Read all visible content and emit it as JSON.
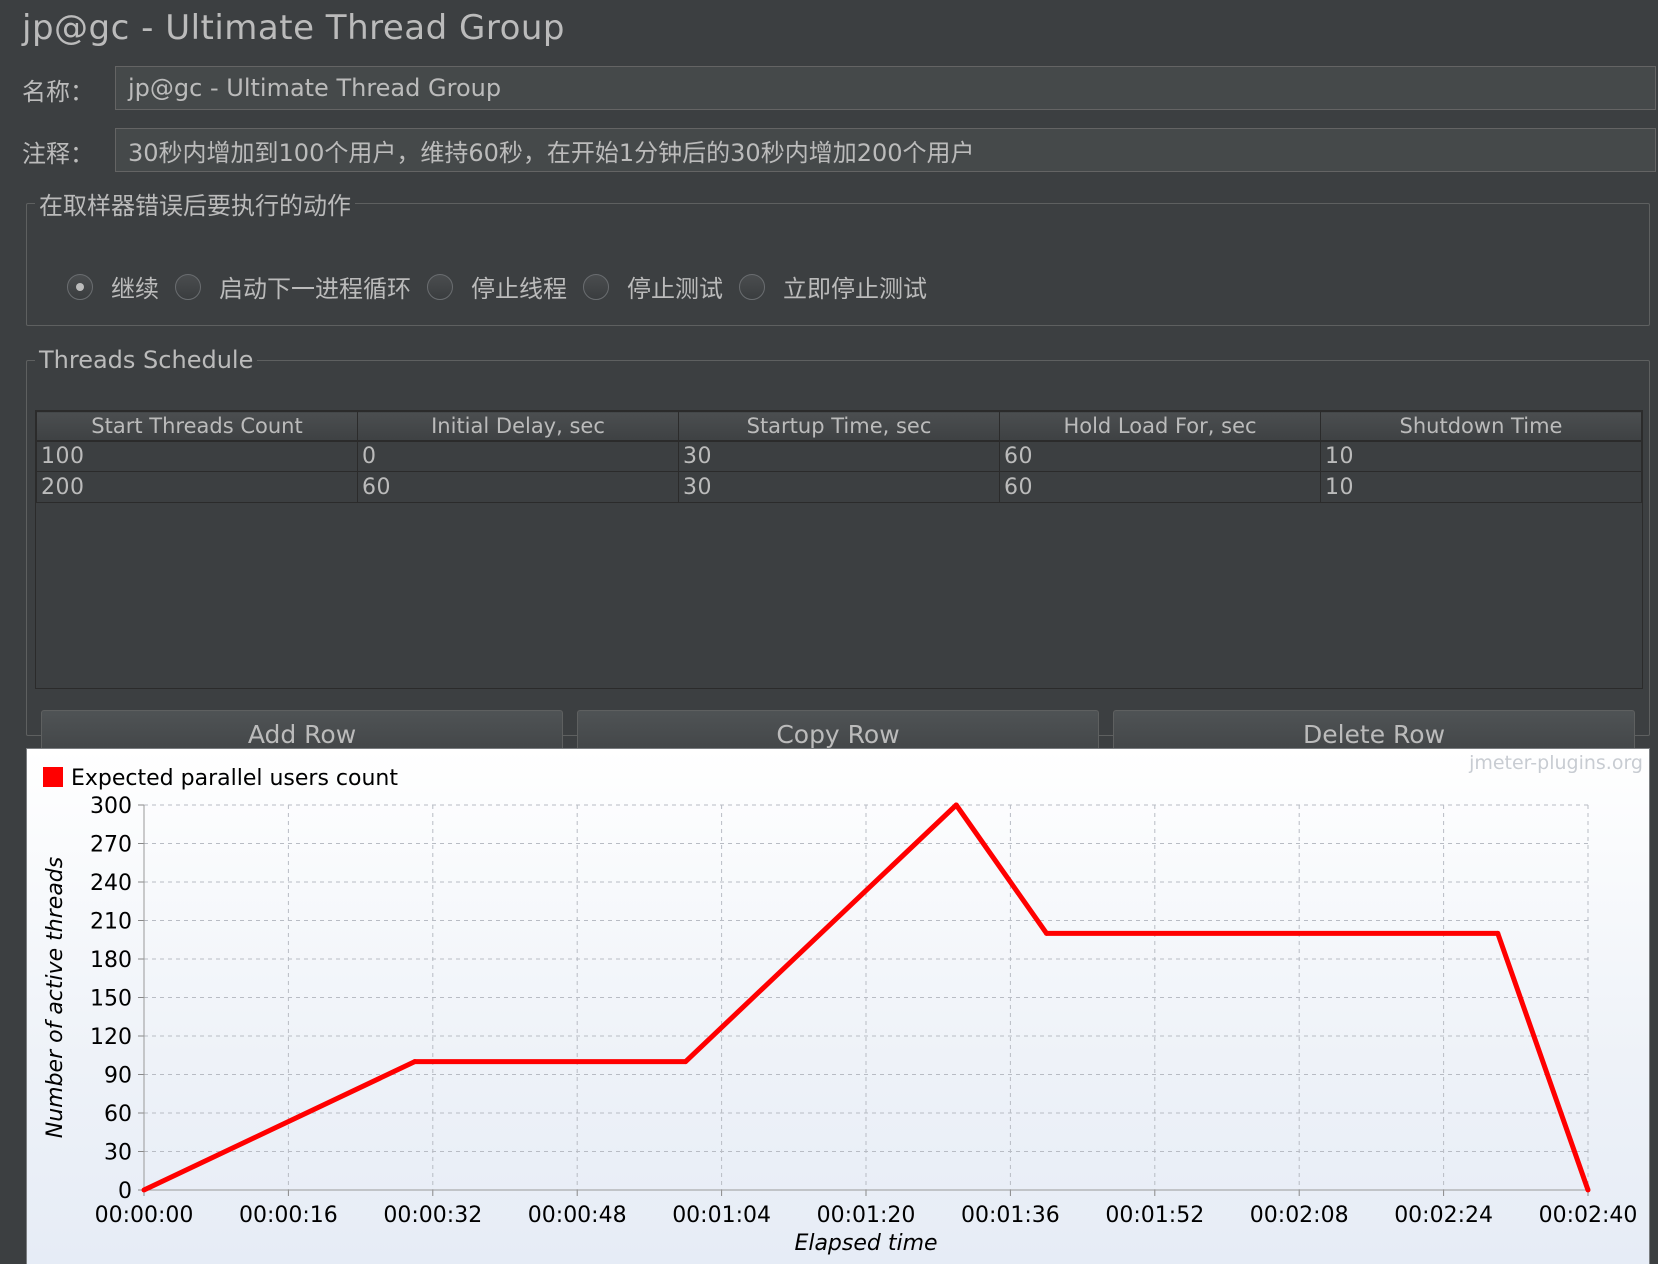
{
  "header": {
    "title": "jp@gc - Ultimate Thread Group"
  },
  "name_field": {
    "label": "名称：",
    "value": "jp@gc - Ultimate Thread Group"
  },
  "comment_field": {
    "label": "注释：",
    "value": "30秒内增加到100个用户，维持60秒，在开始1分钟后的30秒内增加200个用户"
  },
  "sampler_error": {
    "legend": "在取样器错误后要执行的动作",
    "options": [
      {
        "label": "继续",
        "selected": true
      },
      {
        "label": "启动下一进程循环",
        "selected": false
      },
      {
        "label": "停止线程",
        "selected": false
      },
      {
        "label": "停止测试",
        "selected": false
      },
      {
        "label": "立即停止测试",
        "selected": false
      }
    ]
  },
  "schedule": {
    "legend": "Threads Schedule",
    "columns": [
      "Start Threads Count",
      "Initial Delay, sec",
      "Startup Time, sec",
      "Hold Load For, sec",
      "Shutdown Time"
    ],
    "rows": [
      [
        "100",
        "0",
        "30",
        "60",
        "10"
      ],
      [
        "200",
        "60",
        "30",
        "60",
        "10"
      ]
    ],
    "buttons": {
      "add": "Add Row",
      "copy": "Copy Row",
      "delete": "Delete Row"
    }
  },
  "chart_data": {
    "type": "line",
    "watermark": "jmeter-plugins.org",
    "legend": "Expected parallel users count",
    "legend_placement": "top-left",
    "series_color": "#ff0000",
    "xlabel": "Elapsed time",
    "ylabel": "Number of active threads",
    "ylim": [
      0,
      300
    ],
    "yticks": [
      "0",
      "30",
      "60",
      "90",
      "120",
      "150",
      "180",
      "210",
      "240",
      "270",
      "300"
    ],
    "xlim_seconds": [
      0,
      160
    ],
    "xticks": [
      "00:00:00",
      "00:00:16",
      "00:00:32",
      "00:00:48",
      "00:01:04",
      "00:01:20",
      "00:01:36",
      "00:01:52",
      "00:02:08",
      "00:02:24",
      "00:02:40"
    ],
    "grid": true,
    "series": [
      {
        "name": "Expected parallel users count",
        "x_seconds": [
          0,
          30,
          60,
          90,
          100,
          150,
          160
        ],
        "values": [
          0,
          100,
          100,
          300,
          200,
          200,
          0
        ]
      }
    ]
  }
}
